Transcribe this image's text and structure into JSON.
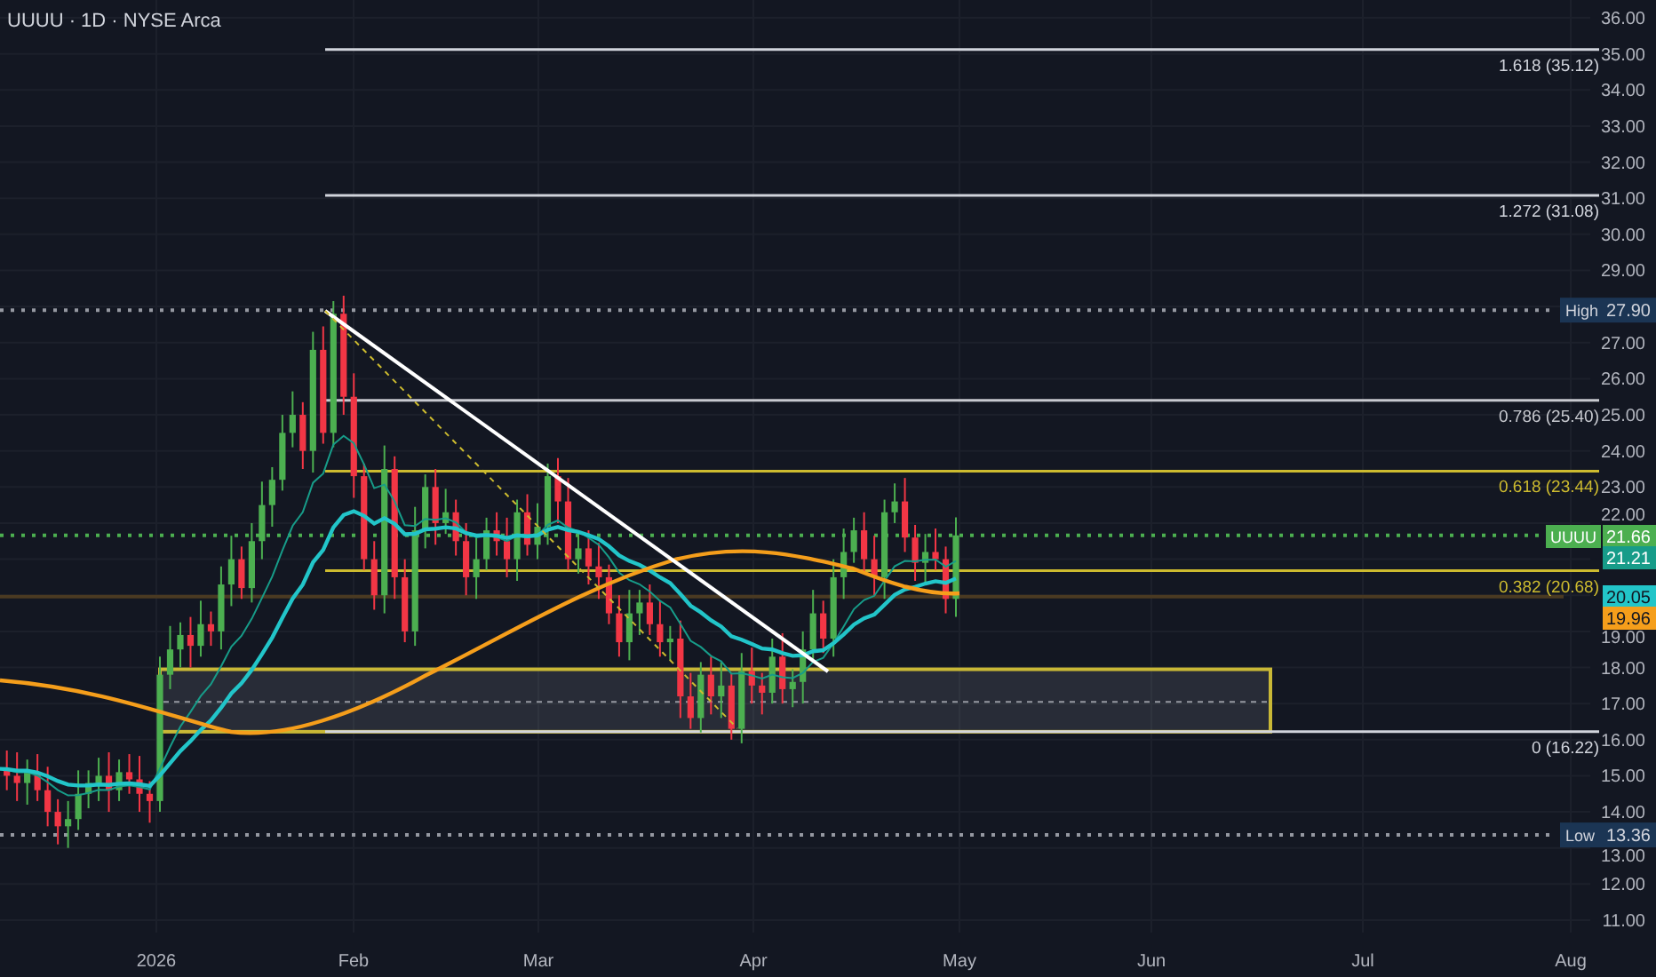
{
  "header": {
    "title": "UUUU · 1D · NYSE Arca"
  },
  "price_axis": {
    "ticks": [
      "36.00",
      "35.00",
      "34.00",
      "33.00",
      "32.00",
      "31.00",
      "30.00",
      "29.00",
      "27.00",
      "26.00",
      "25.00",
      "24.00",
      "23.00",
      "22.00",
      "19.00",
      "18.00",
      "17.00",
      "16.00",
      "15.00",
      "14.00",
      "13.00",
      "12.00",
      "11.00"
    ]
  },
  "time_axis": {
    "ticks": [
      "2026",
      "Feb",
      "Mar",
      "Apr",
      "May",
      "Jun",
      "Jul",
      "Aug"
    ]
  },
  "fib_levels": [
    {
      "label": "1.618 (35.12)",
      "color": "#d1d4dc"
    },
    {
      "label": "1.272 (31.08)",
      "color": "#d1d4dc"
    },
    {
      "label": "0.786 (25.40)",
      "color": "#c7c9cf"
    },
    {
      "label": "0.618 (23.44)",
      "color": "#cdbb2f"
    },
    {
      "label": "0.382 (20.68)",
      "color": "#cdbb2f"
    },
    {
      "label": "0 (16.22)",
      "color": "#d1d4dc"
    }
  ],
  "extreme_markers": [
    {
      "label": "High",
      "value": "27.90"
    },
    {
      "label": "Low",
      "value": "13.36"
    }
  ],
  "price_tags": [
    {
      "label": "UUUU",
      "value": "21.66",
      "color": "#4caf50"
    },
    {
      "value": "21.21",
      "color": "#179c89"
    },
    {
      "value": "20.05",
      "color": "#22c5c9"
    },
    {
      "value": "19.96",
      "color": "#f59e1b"
    }
  ]
}
